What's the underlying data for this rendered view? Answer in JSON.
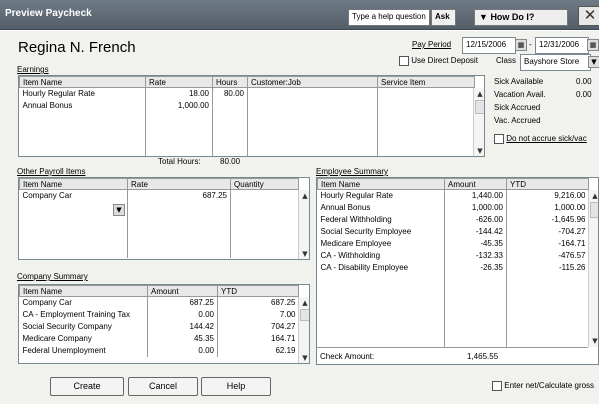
{
  "window": {
    "title": "Preview Paycheck",
    "help_placeholder": "Type a help question",
    "ask_label": "Ask",
    "howdo_label": "How Do I?"
  },
  "employee": {
    "name": "Regina N. French"
  },
  "pay_period": {
    "label": "Pay Period",
    "start": "12/15/2006",
    "separator": "-",
    "end": "12/31/2006"
  },
  "direct_deposit": {
    "label": "Use Direct Deposit",
    "checked": false
  },
  "class_field": {
    "label": "Class",
    "value": "Bayshore Store"
  },
  "earnings": {
    "label": "Earnings",
    "columns": [
      "Item Name",
      "Rate",
      "Hours",
      "Customer:Job",
      "Service Item"
    ],
    "rows": [
      {
        "item": "Hourly Regular Rate",
        "rate": "18.00",
        "hours": "80.00",
        "job": "",
        "service": ""
      },
      {
        "item": "Annual Bonus",
        "rate": "1,000.00",
        "hours": "",
        "job": "",
        "service": ""
      }
    ],
    "total_hours_label": "Total Hours:",
    "total_hours": "80.00"
  },
  "sick_vac": {
    "sick_available_label": "Sick Available",
    "sick_available": "0.00",
    "vac_avail_label": "Vacation Avail.",
    "vac_avail": "0.00",
    "sick_accrued_label": "Sick Accrued",
    "vac_accrued_label": "Vac. Accrued",
    "do_not_accrue_label": "Do not accrue sick/vac"
  },
  "other_payroll": {
    "label": "Other Payroll Items",
    "columns": [
      "Item Name",
      "Rate",
      "Quantity"
    ],
    "rows": [
      {
        "item": "Company Car",
        "rate": "687.25",
        "quantity": ""
      }
    ]
  },
  "company_summary": {
    "label": "Company Summary",
    "columns": [
      "Item Name",
      "Amount",
      "YTD"
    ],
    "rows": [
      {
        "item": "Company Car",
        "amount": "687.25",
        "ytd": "687.25"
      },
      {
        "item": "CA - Employment Training Tax",
        "amount": "0.00",
        "ytd": "7.00"
      },
      {
        "item": "Social Security Company",
        "amount": "144.42",
        "ytd": "704.27"
      },
      {
        "item": "Medicare Company",
        "amount": "45.35",
        "ytd": "164.71"
      },
      {
        "item": "Federal Unemployment",
        "amount": "0.00",
        "ytd": "62.19"
      }
    ]
  },
  "employee_summary": {
    "label": "Employee Summary",
    "columns": [
      "Item Name",
      "Amount",
      "YTD"
    ],
    "rows": [
      {
        "item": "Hourly Regular Rate",
        "amount": "1,440.00",
        "ytd": "9,216.00"
      },
      {
        "item": "Annual Bonus",
        "amount": "1,000.00",
        "ytd": "1,000.00"
      },
      {
        "item": "Federal Withholding",
        "amount": "-626.00",
        "ytd": "-1,645.96"
      },
      {
        "item": "Social Security Employee",
        "amount": "-144.42",
        "ytd": "-704.27"
      },
      {
        "item": "Medicare Employee",
        "amount": "-45.35",
        "ytd": "-164.71"
      },
      {
        "item": "CA - Withholding",
        "amount": "-132.33",
        "ytd": "-476.57"
      },
      {
        "item": "CA - Disability Employee",
        "amount": "-26.35",
        "ytd": "-115.26"
      }
    ],
    "check_amount_label": "Check Amount:",
    "check_amount": "1,465.55"
  },
  "buttons": {
    "create": "Create",
    "cancel": "Cancel",
    "help": "Help"
  },
  "enter_net": {
    "label": "Enter net/Calculate gross",
    "checked": false
  }
}
